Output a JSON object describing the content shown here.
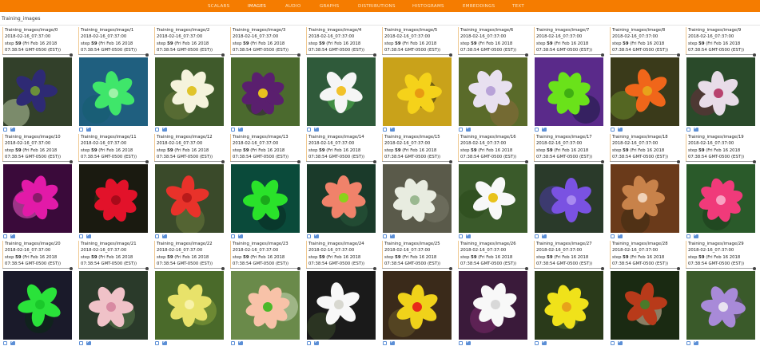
{
  "tabs": [
    "SCALARS",
    "IMAGES",
    "AUDIO",
    "GRAPHS",
    "DISTRIBUTIONS",
    "HISTOGRAMS",
    "EMBEDDINGS",
    "TEXT"
  ],
  "active_tab": "IMAGES",
  "run_label": "Training_images",
  "cards": [
    {
      "tag": "Training_images/image/0",
      "run": "2018-02-16_07:37:00",
      "step_label": "step",
      "step": "59",
      "time1": "(Fri Feb 16 2018",
      "time2": "07:38:54 GMT-0500 (EST))",
      "colors": [
        "#32402a",
        "#2e2a74",
        "#6b8f3a",
        "#b8c9a0"
      ]
    },
    {
      "tag": "Training_images/image/1",
      "run": "2018-02-16_07:37:00",
      "step_label": "step",
      "step": "59",
      "time1": "(Fri Feb 16 2018",
      "time2": "07:38:54 GMT-0500 (EST))",
      "colors": [
        "#1f5f7f",
        "#3fe66a",
        "#9ff2a8",
        "#145c70"
      ]
    },
    {
      "tag": "Training_images/image/2",
      "run": "2018-02-16_07:37:00",
      "step_label": "step",
      "step": "59",
      "time1": "(Fri Feb 16 2018",
      "time2": "07:38:54 GMT-0500 (EST))",
      "colors": [
        "#3f5a2b",
        "#f5f3dc",
        "#e0c42a",
        "#6b7a3a"
      ]
    },
    {
      "tag": "Training_images/image/3",
      "run": "2018-02-16_07:37:00",
      "step_label": "step",
      "step": "59",
      "time1": "(Fri Feb 16 2018",
      "time2": "07:38:54 GMT-0500 (EST))",
      "colors": [
        "#4b6a2e",
        "#5a1f6e",
        "#e8c21e",
        "#2e1a3a"
      ]
    },
    {
      "tag": "Training_images/image/4",
      "run": "2018-02-16_07:37:00",
      "step_label": "step",
      "step": "59",
      "time1": "(Fri Feb 16 2018",
      "time2": "07:38:54 GMT-0500 (EST))",
      "colors": [
        "#2f5a3a",
        "#f5f5f5",
        "#f2c22a",
        "#4fb84a"
      ]
    },
    {
      "tag": "Training_images/image/5",
      "run": "2018-02-16_07:37:00",
      "step_label": "step",
      "step": "59",
      "time1": "(Fri Feb 16 2018",
      "time2": "07:38:54 GMT-0500 (EST))",
      "colors": [
        "#c9a21a",
        "#f5d21a",
        "#e89a12",
        "#2c2a10"
      ]
    },
    {
      "tag": "Training_images/image/6",
      "run": "2018-02-16_07:37:00",
      "step_label": "step",
      "step": "59",
      "time1": "(Fri Feb 16 2018",
      "time2": "07:38:54 GMT-0500 (EST))",
      "colors": [
        "#5a6b2a",
        "#e8e0f0",
        "#b8a2d8",
        "#8a6a3a"
      ]
    },
    {
      "tag": "Training_images/image/7",
      "run": "2018-02-16_07:37:00",
      "step_label": "step",
      "step": "59",
      "time1": "(Fri Feb 16 2018",
      "time2": "07:38:54 GMT-0500 (EST))",
      "colors": [
        "#5a2a8a",
        "#6ae21a",
        "#3fae12",
        "#1a1a40"
      ]
    },
    {
      "tag": "Training_images/image/8",
      "run": "2018-02-16_07:37:00",
      "step_label": "step",
      "step": "59",
      "time1": "(Fri Feb 16 2018",
      "time2": "07:38:54 GMT-0500 (EST))",
      "colors": [
        "#3a3a1a",
        "#f0661a",
        "#e8a21a",
        "#6a8a2a"
      ]
    },
    {
      "tag": "Training_images/image/9",
      "run": "2018-02-16_07:37:00",
      "step_label": "step",
      "step": "59",
      "time1": "(Fri Feb 16 2018",
      "time2": "07:38:54 GMT-0500 (EST))",
      "colors": [
        "#2a4a2a",
        "#e8dce8",
        "#b8426e",
        "#6a2a3a"
      ]
    },
    {
      "tag": "Training_images/image/10",
      "run": "2018-02-16_07:37:00",
      "step_label": "step",
      "step": "59",
      "time1": "(Fri Feb 16 2018",
      "time2": "07:38:54 GMT-0500 (EST))",
      "colors": [
        "#3a0a3a",
        "#e21aa8",
        "#8a1a6a",
        "#f05ac8"
      ]
    },
    {
      "tag": "Training_images/image/11",
      "run": "2018-02-16_07:37:00",
      "step_label": "step",
      "step": "59",
      "time1": "(Fri Feb 16 2018",
      "time2": "07:38:54 GMT-0500 (EST))",
      "colors": [
        "#1a1a10",
        "#e2122a",
        "#a80a1a",
        "#3a2a12"
      ]
    },
    {
      "tag": "Training_images/image/12",
      "run": "2018-02-16_07:37:00",
      "step_label": "step",
      "step": "59",
      "time1": "(Fri Feb 16 2018",
      "time2": "07:38:54 GMT-0500 (EST))",
      "colors": [
        "#3a4a2a",
        "#e8322a",
        "#b81a1a",
        "#6a7a3a"
      ]
    },
    {
      "tag": "Training_images/image/13",
      "run": "2018-02-16_07:37:00",
      "step_label": "step",
      "step": "59",
      "time1": "(Fri Feb 16 2018",
      "time2": "07:38:54 GMT-0500 (EST))",
      "colors": [
        "#0a4a3a",
        "#2ae22a",
        "#1aa81a",
        "#0a2a20"
      ]
    },
    {
      "tag": "Training_images/image/14",
      "run": "2018-02-16_07:37:00",
      "step_label": "step",
      "step": "59",
      "time1": "(Fri Feb 16 2018",
      "time2": "07:38:54 GMT-0500 (EST))",
      "colors": [
        "#1a3a2a",
        "#f0826a",
        "#8ad21a",
        "#2a5a3a"
      ]
    },
    {
      "tag": "Training_images/image/15",
      "run": "2018-02-16_07:37:00",
      "step_label": "step",
      "step": "59",
      "time1": "(Fri Feb 16 2018",
      "time2": "07:38:54 GMT-0500 (EST))",
      "colors": [
        "#5a5a4a",
        "#e8ece0",
        "#9ab890",
        "#7a7a6a"
      ]
    },
    {
      "tag": "Training_images/image/16",
      "run": "2018-02-16_07:37:00",
      "step_label": "step",
      "step": "59",
      "time1": "(Fri Feb 16 2018",
      "time2": "07:38:54 GMT-0500 (EST))",
      "colors": [
        "#3a5a2a",
        "#f8f8f8",
        "#e8c21a",
        "#2a4a1a"
      ]
    },
    {
      "tag": "Training_images/image/17",
      "run": "2018-02-16_07:37:00",
      "step_label": "step",
      "step": "59",
      "time1": "(Fri Feb 16 2018",
      "time2": "07:38:54 GMT-0500 (EST))",
      "colors": [
        "#2a3a2a",
        "#7a52e2",
        "#a88af0",
        "#4a3aa8"
      ]
    },
    {
      "tag": "Training_images/image/18",
      "run": "2018-02-16_07:37:00",
      "step_label": "step",
      "step": "59",
      "time1": "(Fri Feb 16 2018",
      "time2": "07:38:54 GMT-0500 (EST))",
      "colors": [
        "#6a3a1a",
        "#c8824a",
        "#f0d2b8",
        "#3a2a12"
      ]
    },
    {
      "tag": "Training_images/image/19",
      "run": "2018-02-16_07:37:00",
      "step_label": "step",
      "step": "59",
      "time1": "(Fri Feb 16 2018",
      "time2": "07:38:54 GMT-0500 (EST))",
      "colors": [
        "#2a5a2a",
        "#f03a7a",
        "#f8a2c2",
        "#1a3a1a"
      ]
    },
    {
      "tag": "Training_images/image/20",
      "run": "2018-02-16_07:37:00",
      "step_label": "step",
      "step": "59",
      "time1": "(Fri Feb 16 2018",
      "time2": "07:38:54 GMT-0500 (EST))",
      "colors": [
        "#1a1a2a",
        "#2ae23a",
        "#1ac82a",
        "#0a2a12"
      ]
    },
    {
      "tag": "Training_images/image/21",
      "run": "2018-02-16_07:37:00",
      "step_label": "step",
      "step": "59",
      "time1": "(Fri Feb 16 2018",
      "time2": "07:38:54 GMT-0500 (EST))",
      "colors": [
        "#2a3a2a",
        "#f0c2c8",
        "#d88aa2",
        "#5a7a4a"
      ]
    },
    {
      "tag": "Training_images/image/22",
      "run": "2018-02-16_07:37:00",
      "step_label": "step",
      "step": "59",
      "time1": "(Fri Feb 16 2018",
      "time2": "07:38:54 GMT-0500 (EST))",
      "colors": [
        "#4a6a2a",
        "#e8e26a",
        "#f8f2a8",
        "#8aa23a"
      ]
    },
    {
      "tag": "Training_images/image/23",
      "run": "2018-02-16_07:37:00",
      "step_label": "step",
      "step": "59",
      "time1": "(Fri Feb 16 2018",
      "time2": "07:38:54 GMT-0500 (EST))",
      "colors": [
        "#6a8a4a",
        "#f8c2a8",
        "#4ab82a",
        "#c8d8b8"
      ]
    },
    {
      "tag": "Training_images/image/24",
      "run": "2018-02-16_07:37:00",
      "step_label": "step",
      "step": "59",
      "time1": "(Fri Feb 16 2018",
      "time2": "07:38:54 GMT-0500 (EST))",
      "colors": [
        "#1a1a1a",
        "#f8f8f8",
        "#d8d8d0",
        "#3a4a2a"
      ]
    },
    {
      "tag": "Training_images/image/25",
      "run": "2018-02-16_07:37:00",
      "step_label": "step",
      "step": "59",
      "time1": "(Fri Feb 16 2018",
      "time2": "07:38:54 GMT-0500 (EST))",
      "colors": [
        "#3a2a1a",
        "#f0d21a",
        "#e82a1a",
        "#6a5a2a"
      ]
    },
    {
      "tag": "Training_images/image/26",
      "run": "2018-02-16_07:37:00",
      "step_label": "step",
      "step": "59",
      "time1": "(Fri Feb 16 2018",
      "time2": "07:38:54 GMT-0500 (EST))",
      "colors": [
        "#3a1a3a",
        "#f8f8f8",
        "#d8d8d8",
        "#7a2a6a"
      ]
    },
    {
      "tag": "Training_images/image/27",
      "run": "2018-02-16_07:37:00",
      "step_label": "step",
      "step": "59",
      "time1": "(Fri Feb 16 2018",
      "time2": "07:38:54 GMT-0500 (EST))",
      "colors": [
        "#2a3a1a",
        "#f0e21a",
        "#e8a21a",
        "#4a6a2a"
      ]
    },
    {
      "tag": "Training_images/image/28",
      "run": "2018-02-16_07:37:00",
      "step_label": "step",
      "step": "59",
      "time1": "(Fri Feb 16 2018",
      "time2": "07:38:54 GMT-0500 (EST))",
      "colors": [
        "#1a2a12",
        "#b83a1a",
        "#4a7a2a",
        "#e8c2a8"
      ]
    },
    {
      "tag": "Training_images/image/29",
      "run": "2018-02-16_07:37:00",
      "step_label": "step",
      "step": "59",
      "time1": "(Fri Feb 16 2018",
      "time2": "07:38:54 GMT-0500 (EST))",
      "colors": [
        "#3a5a2a",
        "#a88ad8",
        "#e8e2f0",
        "#6a4a8a"
      ]
    }
  ]
}
